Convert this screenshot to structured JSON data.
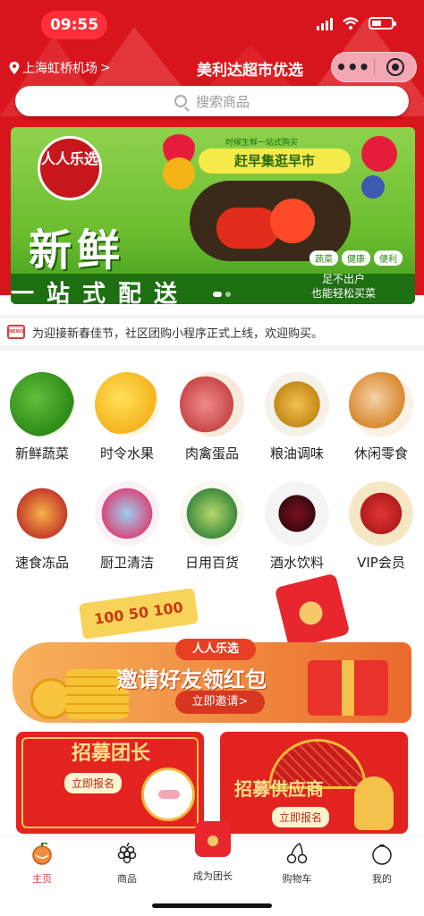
{
  "status_bar": {
    "time": "09:55"
  },
  "header": {
    "location": "上海虹桥机场",
    "location_chevron": ">",
    "title": "美利达超市优选",
    "menu_dots": "•••"
  },
  "search": {
    "placeholder": "搜索商品"
  },
  "banner": {
    "logo_text": "人人乐选",
    "tagline_top": "时候生鲜一站式购买",
    "ribbon": "赶早集逛早市",
    "big_word": "新鲜",
    "chips": [
      "蔬菜",
      "健康",
      "便利"
    ],
    "bottom_text": "一站式配送",
    "slogan_line1": "足不出户",
    "slogan_line2": "也能轻松买菜"
  },
  "notice": {
    "icon": "NEWS",
    "text": "为迎接新春佳节，社区团购小程序正式上线，欢迎购买。"
  },
  "categories": [
    {
      "label": "新鲜蔬菜",
      "icon": "vegetables-icon"
    },
    {
      "label": "时令水果",
      "icon": "fruit-icon"
    },
    {
      "label": "肉禽蛋品",
      "icon": "meat-egg-icon"
    },
    {
      "label": "粮油调味",
      "icon": "grain-oil-icon"
    },
    {
      "label": "休闲零食",
      "icon": "snacks-icon"
    },
    {
      "label": "速食冻品",
      "icon": "frozen-food-icon"
    },
    {
      "label": "厨卫清洁",
      "icon": "cleaning-icon"
    },
    {
      "label": "日用百货",
      "icon": "daily-goods-icon"
    },
    {
      "label": "酒水饮料",
      "icon": "drinks-icon"
    },
    {
      "label": "VIP会员",
      "icon": "vip-gift-icon"
    }
  ],
  "invite_banner": {
    "tickets": "100 50 100",
    "brand": "人人乐选",
    "headline": "邀请好友领红包",
    "cta": "立即邀请>"
  },
  "recruit_cards": [
    {
      "title": "招募团长",
      "button": "立即报名"
    },
    {
      "title": "招募供应商",
      "button": "立即报名"
    }
  ],
  "tabbar": {
    "items": [
      {
        "label": "主页",
        "icon": "home-fruit-icon",
        "active": true
      },
      {
        "label": "商品",
        "icon": "grapes-icon",
        "active": false
      },
      {
        "label": "成为团长",
        "icon": "red-envelope-icon",
        "active": false
      },
      {
        "label": "购物车",
        "icon": "cherries-icon",
        "active": false
      },
      {
        "label": "我的",
        "icon": "profile-fruit-icon",
        "active": false
      }
    ]
  },
  "colors": {
    "brand_red": "#d8151c",
    "active_tab": "#e23a3a",
    "banner_green": "#6bbd2e"
  }
}
